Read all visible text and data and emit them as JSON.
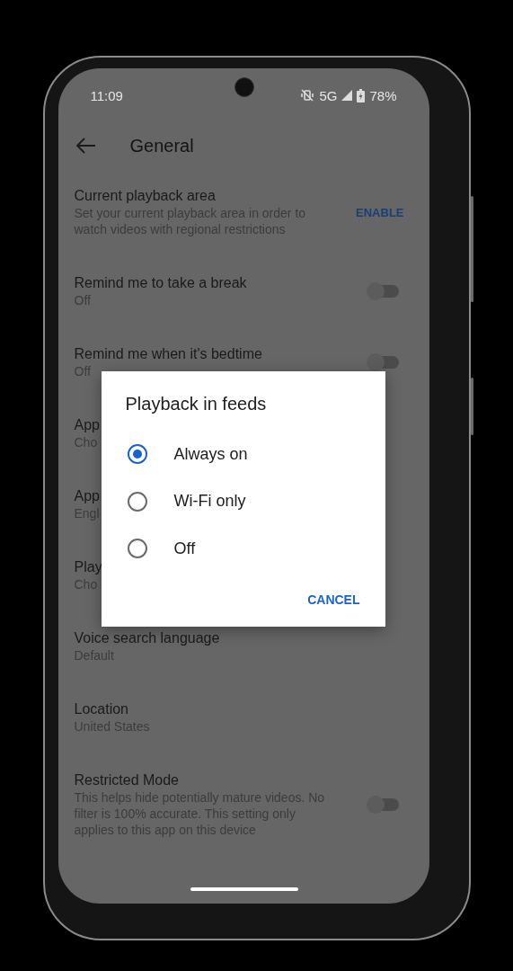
{
  "status_bar": {
    "time": "11:09",
    "network": "5G",
    "battery": "78%"
  },
  "header": {
    "title": "General"
  },
  "settings": [
    {
      "kind": "action",
      "title": "Current playback area",
      "subtitle": "Set your current playback area in order to watch videos with regional restrictions",
      "action": "ENABLE"
    },
    {
      "kind": "toggle",
      "title": "Remind me to take a break",
      "subtitle": "Off",
      "on": false
    },
    {
      "kind": "toggle",
      "title": "Remind me when it's bedtime",
      "subtitle": "Off",
      "on": false
    },
    {
      "kind": "plain",
      "title": "App",
      "subtitle": "Cho"
    },
    {
      "kind": "plain",
      "title": "App",
      "subtitle": "Engl"
    },
    {
      "kind": "plain",
      "title": "Play",
      "subtitle": "Cho"
    },
    {
      "kind": "plain",
      "title": "Voice search language",
      "subtitle": "Default"
    },
    {
      "kind": "plain",
      "title": "Location",
      "subtitle": "United States"
    },
    {
      "kind": "toggle",
      "title": "Restricted Mode",
      "subtitle": "This helps hide potentially mature videos. No filter is 100% accurate. This setting only applies to this app on this device",
      "on": false
    }
  ],
  "dialog": {
    "title": "Playback in feeds",
    "options": [
      {
        "label": "Always on",
        "selected": true
      },
      {
        "label": "Wi-Fi only",
        "selected": false
      },
      {
        "label": "Off",
        "selected": false
      }
    ],
    "button": "CANCEL"
  }
}
